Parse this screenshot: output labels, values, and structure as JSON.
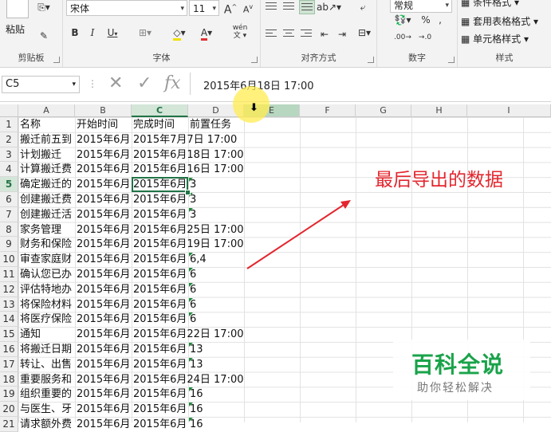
{
  "ribbon": {
    "clipboard": {
      "paste": "粘贴",
      "group": "剪贴板"
    },
    "font": {
      "name": "宋体",
      "size": "11",
      "bold": "B",
      "italic": "I",
      "underline": "U",
      "grow": "A",
      "shrink": "A",
      "wen": "wén",
      "wen_sub": "文",
      "group": "字体"
    },
    "alignment": {
      "group": "对齐方式"
    },
    "number": {
      "format": "常规",
      "percent": "%",
      "comma": ",",
      "group": "数字"
    },
    "styles": {
      "cond_format": "条件格式",
      "table_format": "套用表格格式",
      "cell_style": "单元格样式",
      "group": "样式"
    }
  },
  "formula_bar": {
    "name_box": "C5",
    "fx": "fx",
    "content": "2015年6月18日  17:00"
  },
  "columns": [
    "A",
    "B",
    "C",
    "D",
    "E",
    "F",
    "G",
    "H",
    "I"
  ],
  "rows": [
    "1",
    "2",
    "3",
    "4",
    "5",
    "6",
    "7",
    "8",
    "9",
    "10",
    "11",
    "12",
    "13",
    "14",
    "15",
    "16",
    "17",
    "18",
    "19",
    "20",
    "21"
  ],
  "sheet": [
    [
      "名称",
      "开始时间",
      "完成时间",
      "前置任务"
    ],
    [
      "搬迁前五到",
      "2015年6月",
      "2015年7月7日  17:00",
      ""
    ],
    [
      "计划搬迁",
      "2015年6月",
      "2015年6月18日  17:00",
      ""
    ],
    [
      "计算搬迁费",
      "2015年6月",
      "2015年6月16日  17:00",
      ""
    ],
    [
      "确定搬迁的",
      "2015年6月",
      "2015年6月",
      "3"
    ],
    [
      "创建搬迁费",
      "2015年6月",
      "2015年6月",
      "3"
    ],
    [
      "创建搬迁活",
      "2015年6月",
      "2015年6月",
      "3"
    ],
    [
      "家务管理",
      "2015年6月",
      "2015年6月25日  17:00",
      ""
    ],
    [
      "财务和保险",
      "2015年6月",
      "2015年6月19日  17:00",
      ""
    ],
    [
      "审查家庭财",
      "2015年6月",
      "2015年6月",
      "6,4"
    ],
    [
      "确认您已办",
      "2015年6月",
      "2015年6月",
      "6"
    ],
    [
      "评估特地办",
      "2015年6月",
      "2015年6月",
      "6"
    ],
    [
      "将保险材料",
      "2015年6月",
      "2015年6月",
      "6"
    ],
    [
      "将医疗保险",
      "2015年6月",
      "2015年6月",
      "6"
    ],
    [
      "通知",
      "2015年6月",
      "2015年6月22日  17:00",
      ""
    ],
    [
      "将搬迁日期",
      "2015年6月",
      "2015年6月",
      "13"
    ],
    [
      "转让、出售",
      "2015年6月",
      "2015年6月",
      "13"
    ],
    [
      "重要服务和",
      "2015年6月",
      "2015年6月24日  17:00",
      ""
    ],
    [
      "组织重要的",
      "2015年6月",
      "2015年6月",
      "16"
    ],
    [
      "与医生、牙",
      "2015年6月",
      "2015年6月",
      "16"
    ],
    [
      "请求额外费",
      "2015年6月",
      "2015年6月",
      "16"
    ]
  ],
  "annotation": "最后导出的数据",
  "watermark": {
    "title": "百科全说",
    "subtitle": "助你轻松解决"
  },
  "colors": {
    "annotation_red": "#e3262e",
    "watermark_green": "#1aa34a",
    "selected_col": "#b7d7c0"
  }
}
